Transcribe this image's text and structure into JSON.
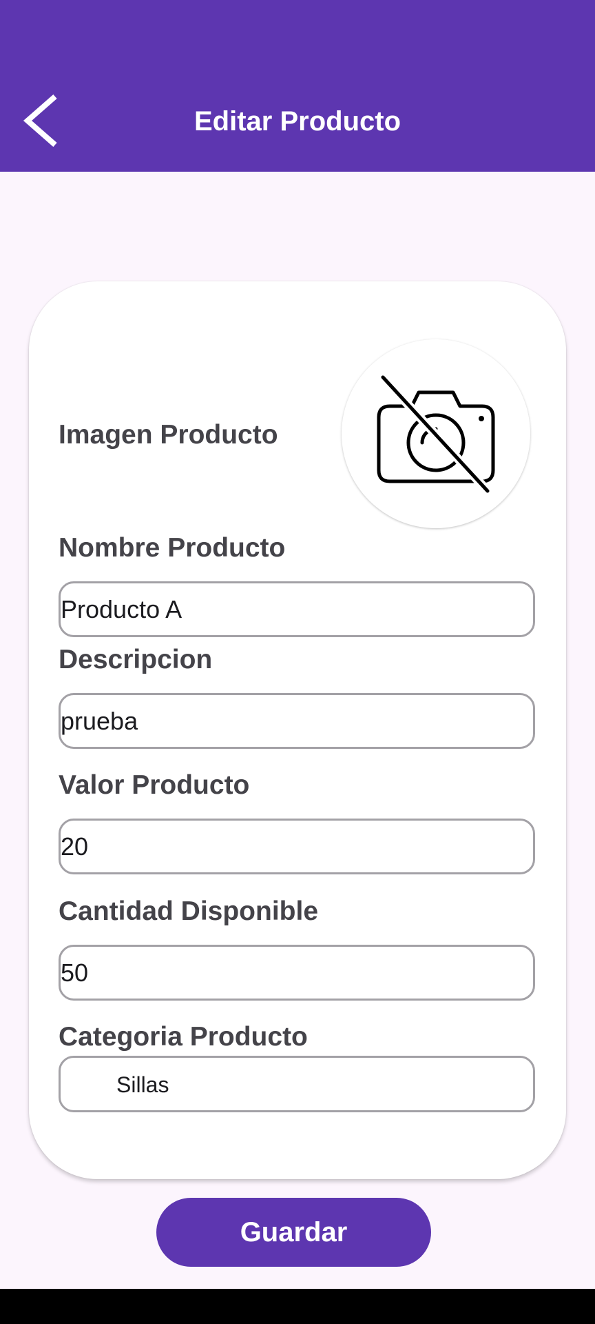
{
  "header": {
    "title": "Editar Producto",
    "back_icon": "chevron-left-icon",
    "background": "#5d36b0"
  },
  "form": {
    "image_label": "Imagen Producto",
    "image_icon": "camera-off-icon",
    "name_label": "Nombre Producto",
    "name_value": "Producto A",
    "description_label": "Descripcion",
    "description_value": "prueba",
    "price_label": "Valor Producto",
    "price_value": "20",
    "stock_label": "Cantidad Disponible",
    "stock_value": "50",
    "category_label": "Categoria Producto",
    "category_value": "Sillas"
  },
  "actions": {
    "save_label": "Guardar"
  },
  "colors": {
    "primary": "#5d36b0",
    "background": "#fcf5fd",
    "label_text": "#444349",
    "field_border": "#a3a1a6"
  }
}
